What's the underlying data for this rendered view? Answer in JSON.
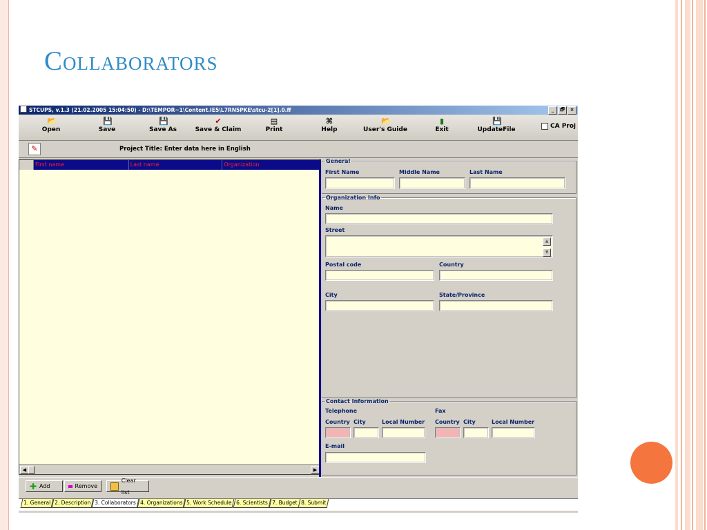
{
  "slide": {
    "title": "Collaborators",
    "colors": {
      "title": "#2e8bc6",
      "accent_circle": "#f4763e",
      "border": "#f0b49a"
    }
  },
  "window": {
    "title": "STCUPS, v.1.3 (21.02.2005 15:04:50) - D:\\TEMPOR~1\\Content.IE5\\L7RN5PKE\\stcu-2[1].0.ff",
    "controls": {
      "minimize": "_",
      "maximize": "🗗",
      "close": "×"
    }
  },
  "toolbar": {
    "buttons": [
      {
        "label": "Open",
        "icon": "open-folder-icon",
        "glyph": "📂"
      },
      {
        "label": "Save",
        "icon": "save-icon",
        "glyph": "💾"
      },
      {
        "label": "Save As",
        "icon": "save-as-icon",
        "glyph": "💾"
      },
      {
        "label": "Save & Claim",
        "icon": "checkmark-icon",
        "glyph": "✔"
      },
      {
        "label": "Print",
        "icon": "print-icon",
        "glyph": "▤"
      },
      {
        "label": "Help",
        "icon": "help-icon",
        "glyph": "⌘"
      },
      {
        "label": "User's Guide",
        "icon": "guide-icon",
        "glyph": "📂"
      },
      {
        "label": "Exit",
        "icon": "exit-icon",
        "glyph": "▮"
      },
      {
        "label": "UpdateFile",
        "icon": "update-icon",
        "glyph": "💾"
      }
    ],
    "ca_proj_label": "CA Proj"
  },
  "project": {
    "title_label": "Project Title: Enter data here in English"
  },
  "grid": {
    "columns": [
      "First name",
      "Last name",
      "Organization"
    ],
    "rows": []
  },
  "general": {
    "legend": "General",
    "first_name_label": "First Name",
    "middle_name_label": "Middle Name",
    "last_name_label": "Last Name"
  },
  "organization": {
    "legend": "Organization Info",
    "name_label": "Name",
    "street_label": "Street",
    "postal_code_label": "Postal code",
    "country_label": "Country",
    "city_label": "City",
    "state_label": "State/Province"
  },
  "contact": {
    "legend": "Contact Information",
    "telephone_label": "Telephone",
    "fax_label": "Fax",
    "tel_country_label": "Country",
    "tel_city_label": "City",
    "tel_local_label": "Local Number",
    "fax_country_label": "Country",
    "fax_city_label": "City",
    "fax_local_label": "Local Number",
    "email_label": "E-mail"
  },
  "actions": {
    "add_label": "Add",
    "remove_label": "Remove",
    "clear_label": "Clear list"
  },
  "tabs": [
    "1. General",
    "2. Description",
    "3. Collaborators",
    "4. Organizations",
    "5. Work Schedule",
    "6. Scientists",
    "7. Budget",
    "8. Submit"
  ],
  "active_tab": "3. Collaborators"
}
